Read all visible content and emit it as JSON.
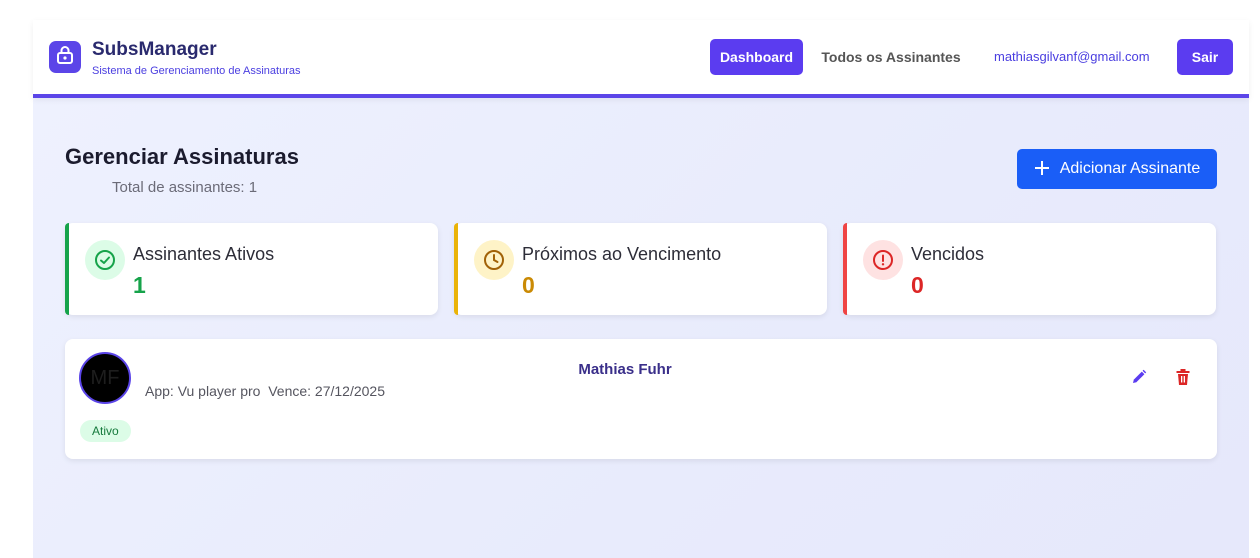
{
  "header": {
    "brand_title": "SubsManager",
    "brand_subtitle": "Sistema de Gerenciamento de Assinaturas",
    "logo_icon": "lock-icon",
    "nav": {
      "dashboard": "Dashboard",
      "todos": "Todos os Assinantes",
      "email": "mathiasgilvanf@gmail.com",
      "sair": "Sair"
    }
  },
  "main": {
    "title": "Gerenciar Assinaturas",
    "total": "Total de assinantes: 1",
    "add_button": "Adicionar Assinante",
    "add_icon": "plus-icon"
  },
  "stats": [
    {
      "label": "Assinantes Ativos",
      "value": "1",
      "icon": "check-circle-icon",
      "color": "#16a34a",
      "bg": "#dcfce7"
    },
    {
      "label": "Próximos ao Vencimento",
      "value": "0",
      "icon": "clock-icon",
      "color": "#ca8a04",
      "bg": "#fef3c7"
    },
    {
      "label": "Vencidos",
      "value": "0",
      "icon": "alert-circle-icon",
      "color": "#dc2626",
      "bg": "#fee2e2"
    }
  ],
  "subscriber": {
    "initials": "MF",
    "name": "Mathias Fuhr",
    "meta": "App: Vu player pro  Vence: 27/12/2025",
    "status": "Ativo"
  },
  "colors": {
    "primary": "#5b3cf0",
    "accent_blue": "#1a5ef7",
    "danger": "#dc2626"
  }
}
